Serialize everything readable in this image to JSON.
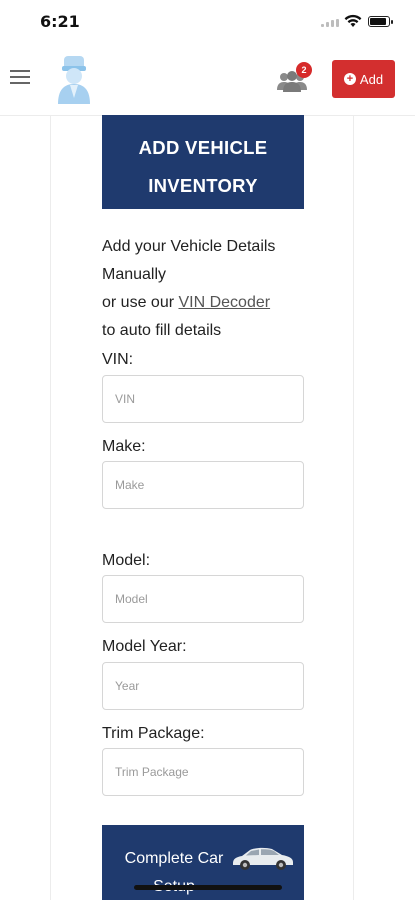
{
  "status_bar": {
    "time": "6:21"
  },
  "header": {
    "menu_icon": "menu-icon",
    "logo_icon": "person-logo-icon",
    "users_icon": "users-icon",
    "notification_count": "2",
    "add_button_label": "Add",
    "accent_color": "#d32f2f"
  },
  "main": {
    "banner_title_line1": "ADD VEHICLE",
    "banner_title_line2": "INVENTORY",
    "intro_line1": "Add your Vehicle Details",
    "intro_line2": "Manually",
    "intro_line3_prefix": "or use our ",
    "vin_decoder_link": "VIN Decoder",
    "intro_line4": "to auto fill details",
    "fields": [
      {
        "label": "VIN:",
        "placeholder": "VIN",
        "value": ""
      },
      {
        "label": "Make:",
        "placeholder": "Make",
        "value": ""
      },
      {
        "label": "Model:",
        "placeholder": "Model",
        "value": ""
      },
      {
        "label": "Model Year:",
        "placeholder": "Year",
        "value": ""
      },
      {
        "label": "Trim Package:",
        "placeholder": "Trim Package",
        "value": ""
      }
    ],
    "complete_button_line1": "Complete Car",
    "complete_button_line2": "Setup",
    "car_icon": "car-icon",
    "brand_color": "#1f3a6e"
  }
}
